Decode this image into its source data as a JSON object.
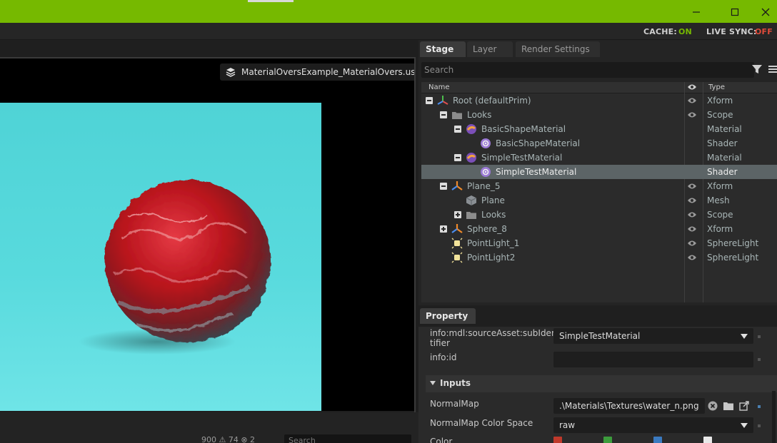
{
  "status": {
    "cache_label": "CACHE:",
    "cache_value": "ON",
    "livesync_label": "LIVE SYNC:",
    "livesync_value": "OFF"
  },
  "viewport": {
    "file_name": "MaterialOversExample_MaterialOvers.usda",
    "console_counts": "900  ⚠ 74  ⊗ 2",
    "console_search_placeholder": "Search"
  },
  "stage": {
    "tabs": [
      {
        "label": "Stage"
      },
      {
        "label": "Layer"
      },
      {
        "label": "Render Settings"
      }
    ],
    "search_placeholder": "Search",
    "columns": {
      "name": "Name",
      "type": "Type"
    },
    "rows": [
      {
        "label": "Root (defaultPrim)",
        "type": "Xform"
      },
      {
        "label": "Looks",
        "type": "Scope"
      },
      {
        "label": "BasicShapeMaterial",
        "type": "Material"
      },
      {
        "label": "BasicShapeMaterial",
        "type": "Shader"
      },
      {
        "label": "SimpleTestMaterial",
        "type": "Material"
      },
      {
        "label": "SimpleTestMaterial",
        "type": "Shader"
      },
      {
        "label": "Plane_5",
        "type": "Xform"
      },
      {
        "label": "Plane",
        "type": "Mesh"
      },
      {
        "label": "Looks",
        "type": "Scope"
      },
      {
        "label": "Sphere_8",
        "type": "Xform"
      },
      {
        "label": "PointLight_1",
        "type": "SphereLight"
      },
      {
        "label": "PointLight2",
        "type": "SphereLight"
      }
    ]
  },
  "property": {
    "tab_label": "Property",
    "sub_identifier_label": "info:mdl:sourceAsset:subIden\ntifier",
    "sub_identifier_value": "SimpleTestMaterial",
    "info_id_label": "info:id",
    "info_id_value": "",
    "inputs_header": "Inputs",
    "normal_map_label": "NormalMap",
    "normal_map_value": ".\\Materials\\Textures\\water_n.png",
    "normal_map_cs_label": "NormalMap Color Space",
    "normal_map_cs_value": "raw",
    "color_label": "Color"
  },
  "colors": {
    "accent": "#76b900",
    "cache_on": "#76b900",
    "livesync_off": "#e04b3a",
    "selected_row": "#5c6466",
    "sky": "#5fd8dd",
    "sphere_red": "#c0161c"
  }
}
